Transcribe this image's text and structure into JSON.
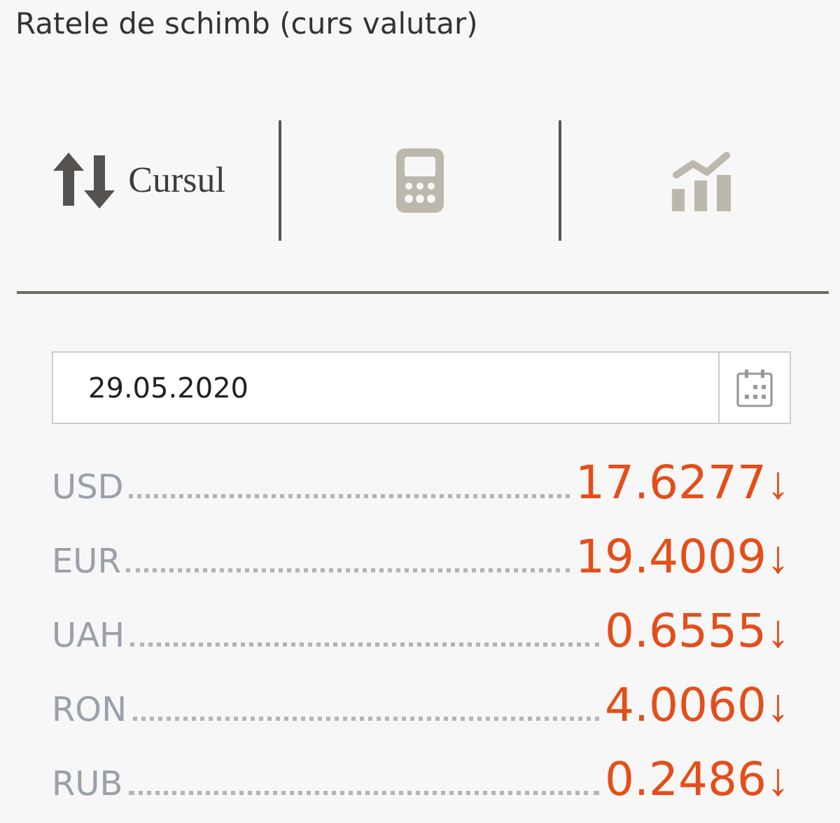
{
  "title": "Ratele de schimb (curs valutar)",
  "tabs": [
    {
      "kind": "rates",
      "label": "Cursul",
      "selected": true
    },
    {
      "kind": "calculator",
      "selected": false
    },
    {
      "kind": "chart",
      "selected": false
    }
  ],
  "date_field": {
    "value": "29.05.2020"
  },
  "rates": [
    {
      "currency": "USD",
      "value": "17.6277",
      "trend": "↓"
    },
    {
      "currency": "EUR",
      "value": "19.4009",
      "trend": "↓"
    },
    {
      "currency": "UAH",
      "value": "0.6555",
      "trend": "↓"
    },
    {
      "currency": "RON",
      "value": "4.0060",
      "trend": "↓"
    },
    {
      "currency": "RUB",
      "value": "0.2486",
      "trend": "↓"
    }
  ]
}
